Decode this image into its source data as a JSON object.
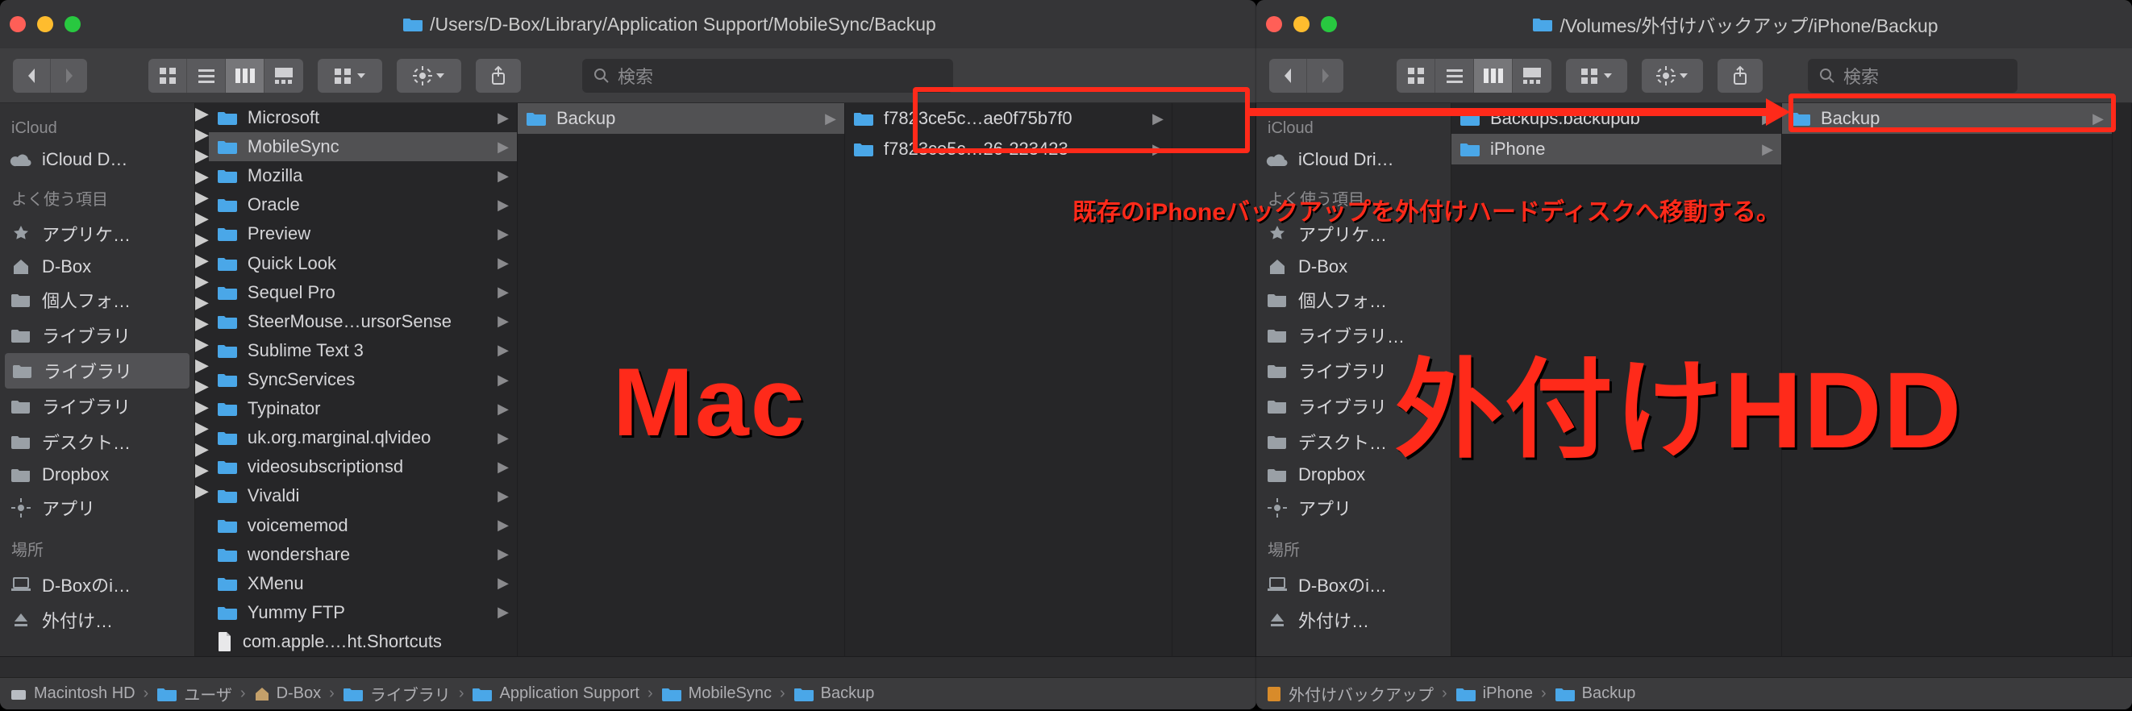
{
  "colors": {
    "traffic_red": "#ff5f57",
    "traffic_yellow": "#febc2e",
    "traffic_green": "#28c840",
    "folder": "#4aa7e8",
    "accent_red": "#ff2a1a",
    "disk": "#9aa0a6",
    "hdd": "#d88b2a"
  },
  "annotations": {
    "mac": "Mac",
    "hdd": "外付けHDD",
    "instruction": "既存のiPhoneバックアップを外付けハードディスクへ移動する。"
  },
  "left": {
    "title_path": "/Users/D-Box/Library/Application Support/MobileSync/Backup",
    "search_placeholder": "検索",
    "sidebar": {
      "icloud_head": "iCloud",
      "icloud_items": [
        {
          "label": "iCloud D…",
          "icon": "cloud",
          "sel": false
        }
      ],
      "fav_head": "よく使う項目",
      "fav_items": [
        {
          "label": "アプリケ…",
          "icon": "apps"
        },
        {
          "label": "D-Box",
          "icon": "home"
        },
        {
          "label": "個人フォ…",
          "icon": "folder"
        },
        {
          "label": "ライブラリ",
          "icon": "folder"
        },
        {
          "label": "ライブラリ",
          "icon": "folder",
          "sel": true
        },
        {
          "label": "ライブラリ",
          "icon": "folder"
        },
        {
          "label": "デスクト…",
          "icon": "folder"
        },
        {
          "label": "Dropbox",
          "icon": "folder"
        },
        {
          "label": "アプリ",
          "icon": "gear"
        }
      ],
      "loc_head": "場所",
      "loc_items": [
        {
          "label": "D-Boxのi…",
          "icon": "laptop"
        },
        {
          "label": "外付け…",
          "icon": "eject"
        }
      ]
    },
    "col1": [
      {
        "label": "Microsoft",
        "type": "folder",
        "sel": false
      },
      {
        "label": "MobileSync",
        "type": "folder",
        "sel": true
      },
      {
        "label": "Mozilla",
        "type": "folder"
      },
      {
        "label": "Oracle",
        "type": "folder"
      },
      {
        "label": "Preview",
        "type": "folder"
      },
      {
        "label": "Quick Look",
        "type": "folder"
      },
      {
        "label": "Sequel Pro",
        "type": "folder"
      },
      {
        "label": "SteerMouse…ursorSense",
        "type": "folder"
      },
      {
        "label": "Sublime Text 3",
        "type": "folder"
      },
      {
        "label": "SyncServices",
        "type": "folder"
      },
      {
        "label": "Typinator",
        "type": "folder"
      },
      {
        "label": "uk.org.marginal.qlvideo",
        "type": "folder"
      },
      {
        "label": "videosubscriptionsd",
        "type": "folder"
      },
      {
        "label": "Vivaldi",
        "type": "folder"
      },
      {
        "label": "voicememod",
        "type": "folder"
      },
      {
        "label": "wondershare",
        "type": "folder"
      },
      {
        "label": "XMenu",
        "type": "folder"
      },
      {
        "label": "Yummy FTP",
        "type": "folder"
      },
      {
        "label": "com.apple.…ht.Shortcuts",
        "type": "file"
      }
    ],
    "col2": [
      {
        "label": "Backup",
        "type": "folder",
        "sel": true
      }
    ],
    "col3": [
      {
        "label": "f7823ce5c…ae0f75b7f0",
        "type": "folder"
      },
      {
        "label": "f7823ce5c…26-223423",
        "type": "folder"
      }
    ],
    "pathbar": [
      "Macintosh HD",
      "ユーザ",
      "D-Box",
      "ライブラリ",
      "Application Support",
      "MobileSync",
      "Backup"
    ]
  },
  "right": {
    "title_path": "/Volumes/外付けバックアップ/iPhone/Backup",
    "search_placeholder": "検索",
    "sidebar": {
      "icloud_head": "iCloud",
      "icloud_items": [
        {
          "label": "iCloud Dri…",
          "icon": "cloud"
        }
      ],
      "fav_head": "よく使う項目",
      "fav_items": [
        {
          "label": "アプリケ…",
          "icon": "apps"
        },
        {
          "label": "D-Box",
          "icon": "home"
        },
        {
          "label": "個人フォ…",
          "icon": "folder"
        },
        {
          "label": "ライブラリ…",
          "icon": "folder"
        },
        {
          "label": "ライブラリ",
          "icon": "folder"
        },
        {
          "label": "ライブラリ",
          "icon": "folder"
        },
        {
          "label": "デスクト…",
          "icon": "folder"
        },
        {
          "label": "Dropbox",
          "icon": "folder"
        },
        {
          "label": "アプリ",
          "icon": "gear"
        }
      ],
      "loc_head": "場所",
      "loc_items": [
        {
          "label": "D-Boxのi…",
          "icon": "laptop"
        },
        {
          "label": "外付け…",
          "icon": "eject"
        }
      ]
    },
    "col1": [
      {
        "label": "Backups.backupdb",
        "type": "folder"
      },
      {
        "label": "iPhone",
        "type": "folder",
        "sel": true
      }
    ],
    "col2": [
      {
        "label": "Backup",
        "type": "folder",
        "sel": true
      }
    ],
    "pathbar": [
      "外付けバックアップ",
      "iPhone",
      "Backup"
    ]
  }
}
